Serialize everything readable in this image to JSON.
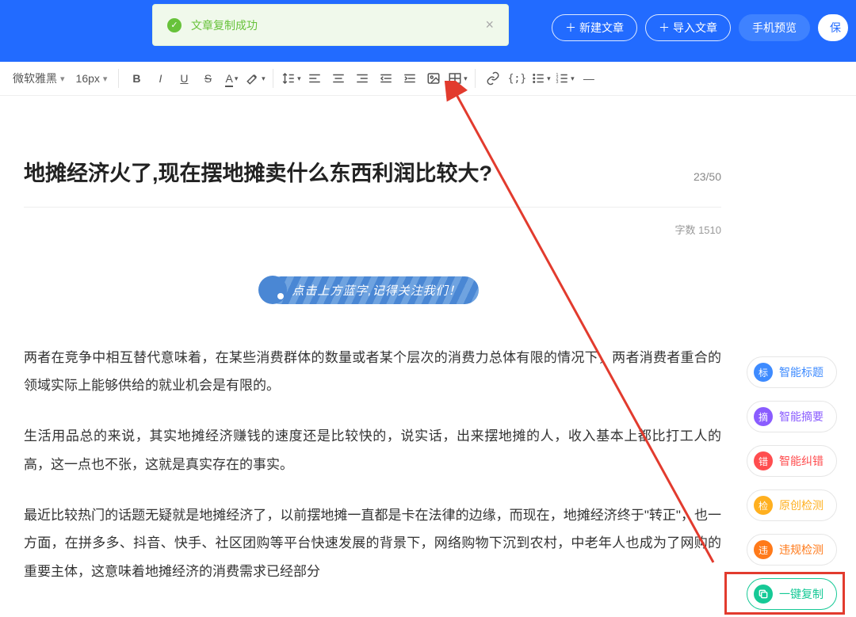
{
  "header": {
    "new_article": "新建文章",
    "import_article": "导入文章",
    "mobile_preview": "手机预览",
    "save": "保"
  },
  "toast": {
    "message": "文章复制成功"
  },
  "toolbar": {
    "font_family": "微软雅黑",
    "font_size": "16px"
  },
  "article": {
    "title": "地摊经济火了,现在摆地摊卖什么东西利润比较大?",
    "title_count": "23/50",
    "word_count_label": "字数 1510",
    "banner_text": "点击上方蓝字,记得关注我们！",
    "p1": "两者在竞争中相互替代意味着，在某些消费群体的数量或者某个层次的消费力总体有限的情况下，两者消费者重合的领域实际上能够供给的就业机会是有限的。",
    "p2": "生活用品总的来说，其实地摊经济赚钱的速度还是比较快的，说实话，出来摆地摊的人，收入基本上都比打工人的高，这一点也不张，这就是真实存在的事实。",
    "p3": "最近比较热门的话题无疑就是地摊经济了，以前摆地摊一直都是卡在法律的边缘，而现在，地摊经济终于\"转正\"，也一方面，在拼多多、抖音、快手、社区团购等平台快速发展的背景下，网络购物下沉到农村，中老年人也成为了网购的重要主体，这意味着地摊经济的消费需求已经部分"
  },
  "side": {
    "items": [
      {
        "badge": "标",
        "label": "智能标题",
        "badge_bg": "#3e8bff",
        "text_color": "#3e8bff"
      },
      {
        "badge": "摘",
        "label": "智能摘要",
        "badge_bg": "#8a5cff",
        "text_color": "#8a5cff"
      },
      {
        "badge": "错",
        "label": "智能纠错",
        "badge_bg": "#ff4d4f",
        "text_color": "#ff4d4f"
      },
      {
        "badge": "检",
        "label": "原创检测",
        "badge_bg": "#ffb020",
        "text_color": "#ffb020"
      },
      {
        "badge": "违",
        "label": "违规检测",
        "badge_bg": "#ff7a1a",
        "text_color": "#ff7a1a"
      },
      {
        "badge": "",
        "label": "一键复制",
        "badge_bg": "#16c996",
        "text_color": "#16c996",
        "icon": "copy"
      }
    ]
  }
}
